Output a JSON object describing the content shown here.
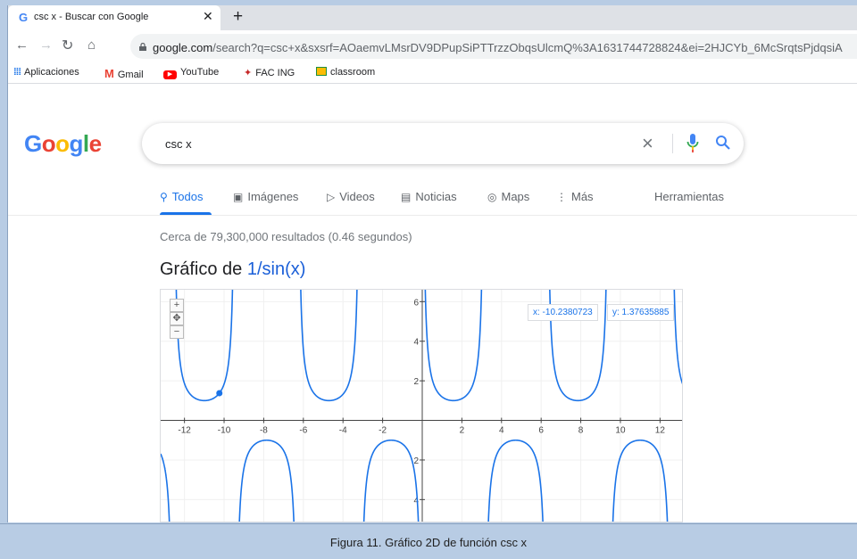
{
  "browser": {
    "tab_title": "csc x - Buscar con Google",
    "tab_favicon": "G",
    "new_tab_label": "+",
    "url_domain": "google.com",
    "url_path": "/search?q=csc+x&sxsrf=AOaemvLMsrDV9DPupSiPTTrzzObqsUlcmQ%3A1631744728824&ei=2HJCYb_6McSrqtsPjdqsiA"
  },
  "bookmarks": [
    {
      "label": "Aplicaciones",
      "icon": "apps-grid-icon"
    },
    {
      "label": "Gmail",
      "icon": "gmail-icon"
    },
    {
      "label": "YouTube",
      "icon": "youtube-icon"
    },
    {
      "label": "FAC ING",
      "icon": "fac-ing-icon"
    },
    {
      "label": "classroom",
      "icon": "classroom-icon"
    }
  ],
  "search": {
    "logo": "Google",
    "query": "csc x"
  },
  "search_tabs": [
    {
      "label": "Todos",
      "icon": "search-icon",
      "active": true
    },
    {
      "label": "Imágenes",
      "icon": "image-icon"
    },
    {
      "label": "Videos",
      "icon": "video-icon"
    },
    {
      "label": "Noticias",
      "icon": "news-icon"
    },
    {
      "label": "Maps",
      "icon": "map-pin-icon"
    },
    {
      "label": "Más",
      "icon": "more-vert-icon"
    },
    {
      "label": "Herramientas",
      "icon": ""
    }
  ],
  "results": {
    "stats": "Cerca de 79,300,000 resultados (0.46 segundos)",
    "graph_heading_prefix": "Gráfico de ",
    "graph_heading_function": "1/sin(x)"
  },
  "graph": {
    "coord_x": "x: -10.2380723",
    "coord_y": "y: 1.37635885",
    "highlight_point": {
      "x": -10.2380723,
      "y": 1.37635885
    },
    "x_ticks": [
      "-12",
      "-10",
      "-8",
      "-6",
      "-4",
      "-2",
      "2",
      "4",
      "6",
      "8",
      "10",
      "12"
    ],
    "y_ticks": [
      "6",
      "4",
      "2",
      "2",
      "4"
    ],
    "y_tick_values": [
      6,
      4,
      2,
      -2,
      -4
    ]
  },
  "chart_data": {
    "type": "line",
    "function": "1/sin(x)",
    "title": "",
    "xlabel": "",
    "ylabel": "",
    "xlim": [
      -13.2,
      13.2
    ],
    "ylim": [
      -5.2,
      6.6
    ],
    "x_tick_values": [
      -12,
      -10,
      -8,
      -6,
      -4,
      -2,
      2,
      4,
      6,
      8,
      10,
      12
    ],
    "y_tick_values": [
      6,
      4,
      2,
      -2,
      -4
    ],
    "grid": true,
    "color": "#1a73e8"
  },
  "caption": "Figura 11. Gráfico 2D de función csc x"
}
